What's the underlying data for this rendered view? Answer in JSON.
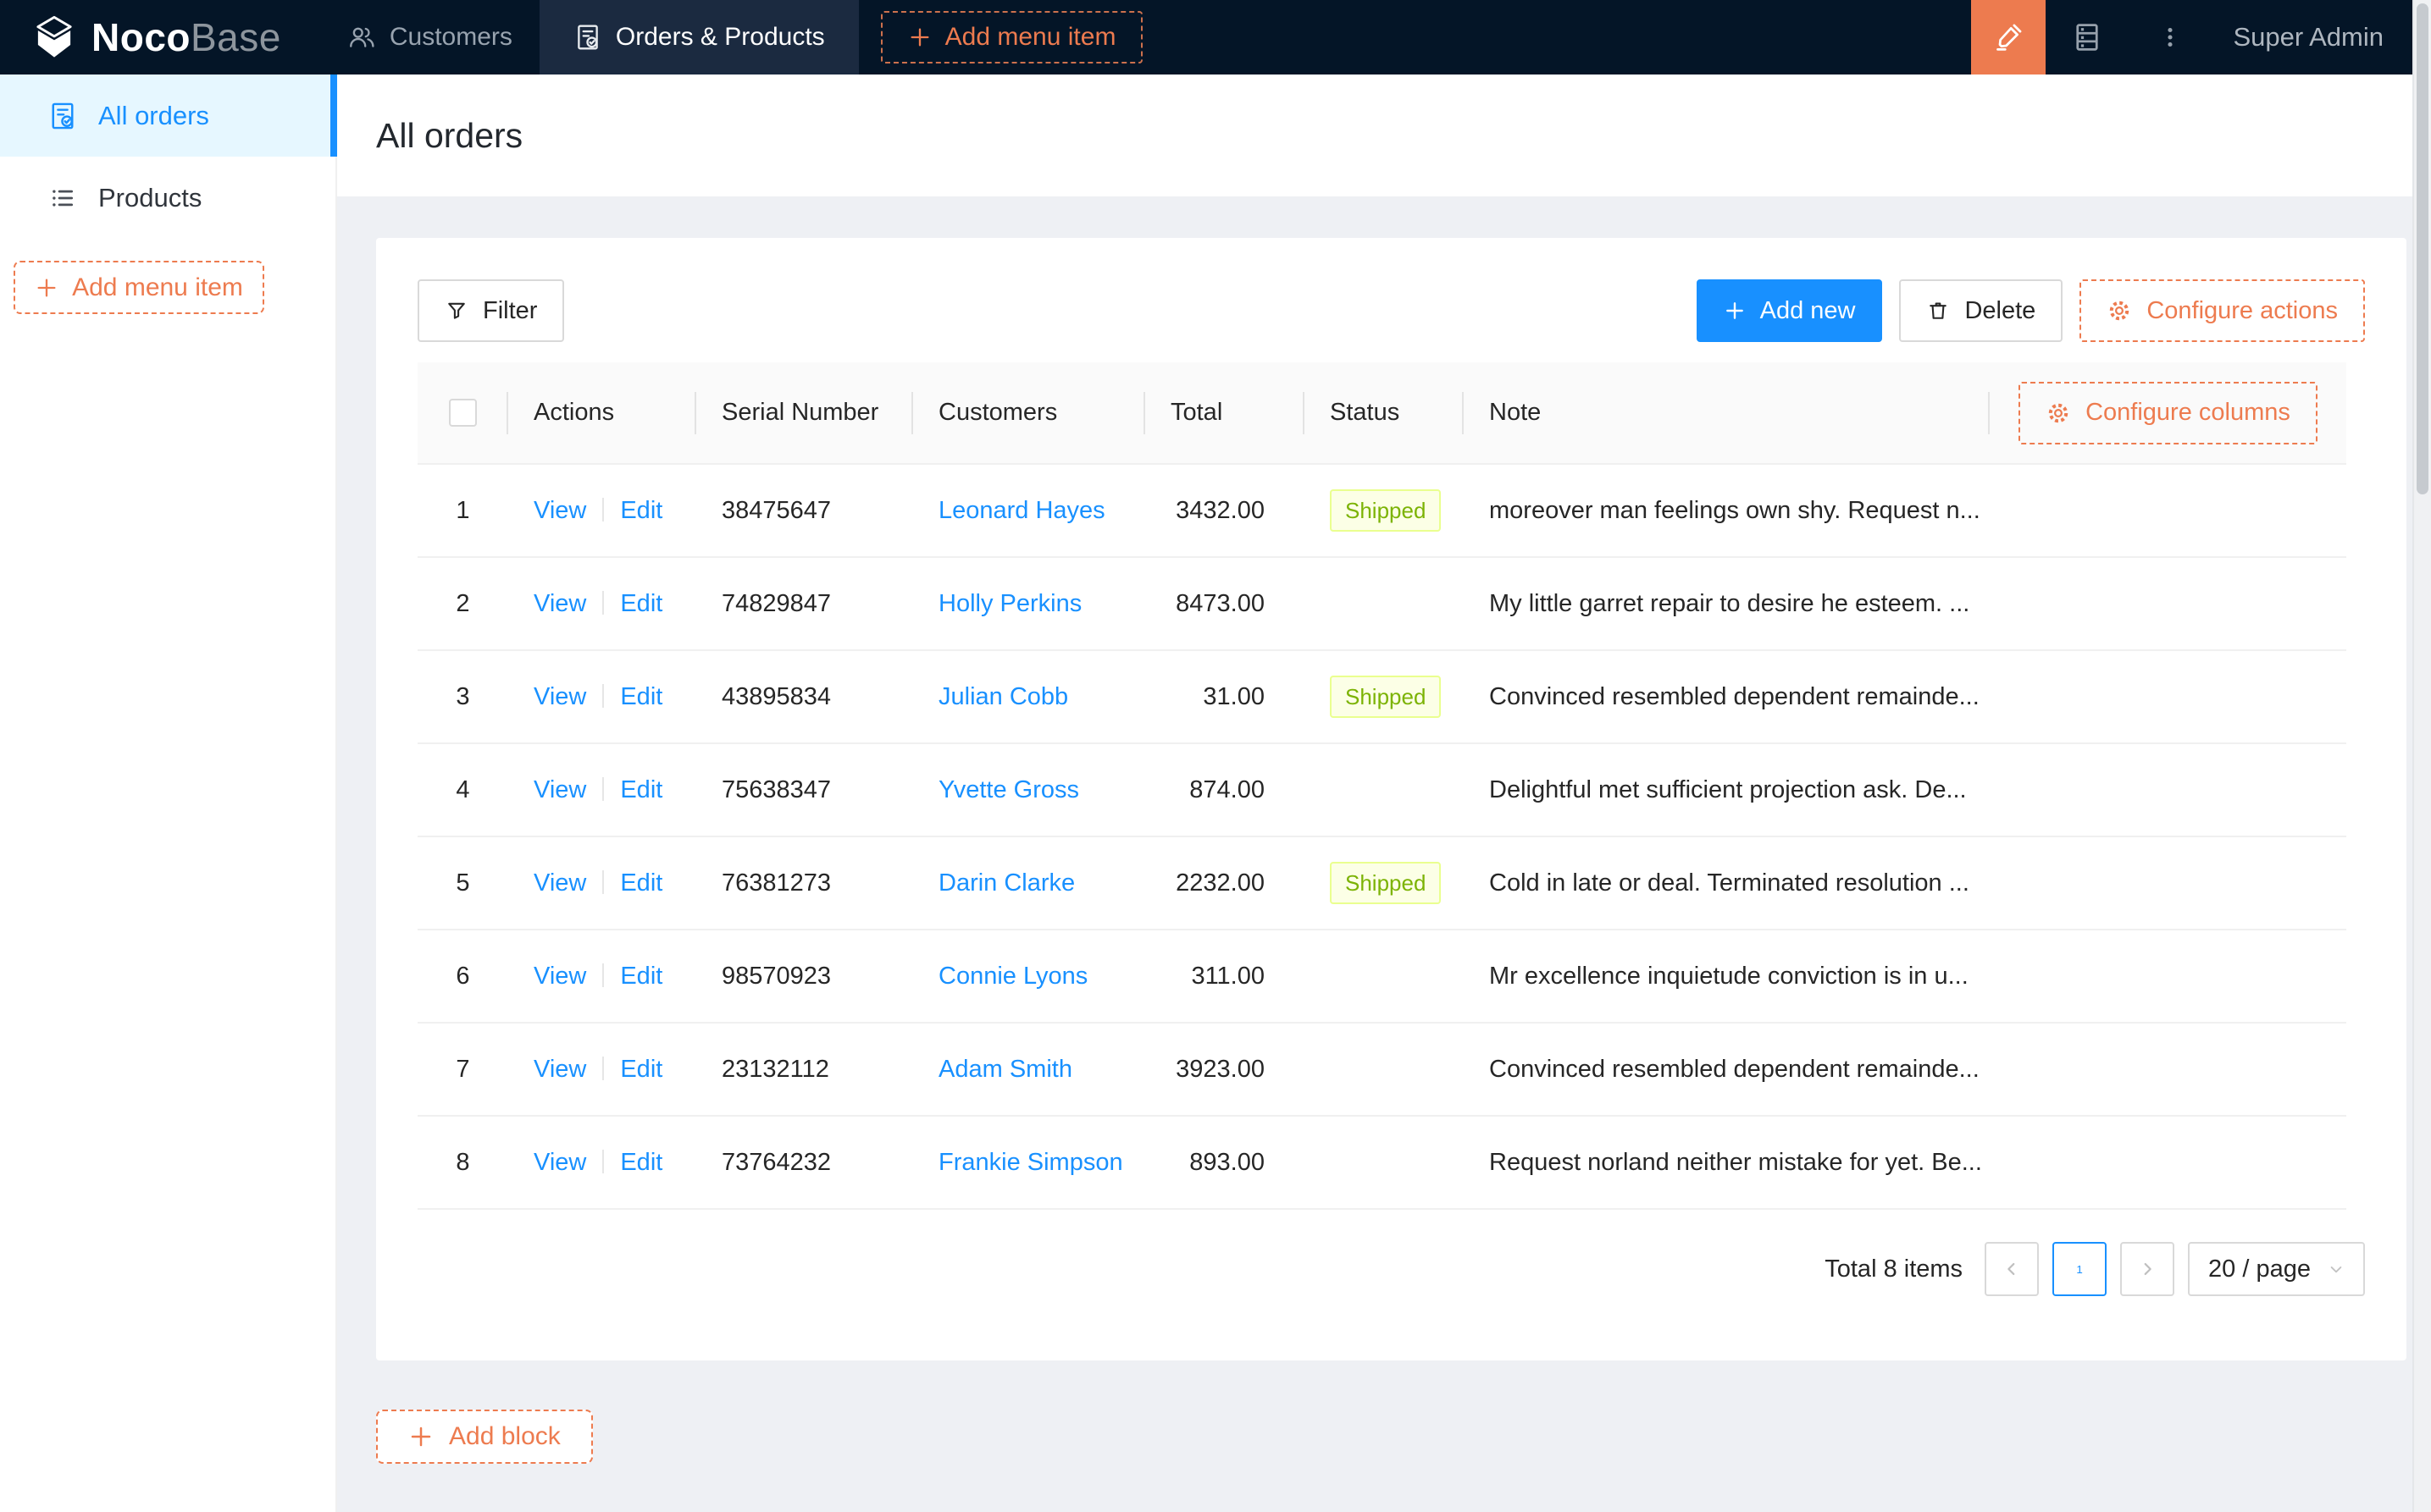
{
  "header": {
    "logo_primary": "Noco",
    "logo_secondary": "Base",
    "nav": [
      {
        "label": "Customers",
        "icon": "team-icon",
        "active": false
      },
      {
        "label": "Orders & Products",
        "icon": "document-check-icon",
        "active": true
      }
    ],
    "add_menu_item_label": "Add menu item",
    "user": "Super Admin"
  },
  "sidebar": {
    "items": [
      {
        "label": "All orders",
        "icon": "document-check-icon",
        "active": true
      },
      {
        "label": "Products",
        "icon": "unordered-list-icon",
        "active": false
      }
    ],
    "add_menu_item_label": "Add menu item"
  },
  "page": {
    "title": "All orders"
  },
  "toolbar": {
    "filter_label": "Filter",
    "add_new_label": "Add new",
    "delete_label": "Delete",
    "configure_actions_label": "Configure actions"
  },
  "table": {
    "columns": [
      "Actions",
      "Serial Number",
      "Customers",
      "Total",
      "Status",
      "Note"
    ],
    "configure_columns_label": "Configure columns",
    "row_actions": [
      "View",
      "Edit"
    ],
    "rows": [
      {
        "index": "1",
        "serial": "38475647",
        "customer": "Leonard Hayes",
        "total": "3432.00",
        "status": "Shipped",
        "note": "moreover man feelings own shy. Request n..."
      },
      {
        "index": "2",
        "serial": "74829847",
        "customer": "Holly Perkins",
        "total": "8473.00",
        "status": "",
        "note": "My little garret repair to desire he esteem. ..."
      },
      {
        "index": "3",
        "serial": "43895834",
        "customer": "Julian Cobb",
        "total": "31.00",
        "status": "Shipped",
        "note": "Convinced resembled dependent remainde..."
      },
      {
        "index": "4",
        "serial": "75638347",
        "customer": "Yvette Gross",
        "total": "874.00",
        "status": "",
        "note": "Delightful met sufficient projection ask. De..."
      },
      {
        "index": "5",
        "serial": "76381273",
        "customer": "Darin Clarke",
        "total": "2232.00",
        "status": "Shipped",
        "note": "Cold in late or deal. Terminated resolution ..."
      },
      {
        "index": "6",
        "serial": "98570923",
        "customer": "Connie Lyons",
        "total": "311.00",
        "status": "",
        "note": "Mr excellence inquietude conviction is in u..."
      },
      {
        "index": "7",
        "serial": "23132112",
        "customer": "Adam Smith",
        "total": "3923.00",
        "status": "",
        "note": "Convinced resembled dependent remainde..."
      },
      {
        "index": "8",
        "serial": "73764232",
        "customer": "Frankie Simpson",
        "total": "893.00",
        "status": "",
        "note": "Request norland neither mistake for yet. Be..."
      }
    ]
  },
  "pagination": {
    "total_text": "Total 8 items",
    "current_page": "1",
    "page_size": "20 / page"
  },
  "add_block_label": "Add block",
  "colors": {
    "header_bg": "#041527",
    "accent_orange": "#ED7B4F",
    "primary_blue": "#1890FF",
    "sidebar_active_bg": "#E6F7FF",
    "tag_shipped_bg": "#FCFFE6",
    "tag_shipped_border": "#EAFF8F",
    "tag_shipped_text": "#7CB305",
    "table_header_bg": "#FAFAFA"
  }
}
